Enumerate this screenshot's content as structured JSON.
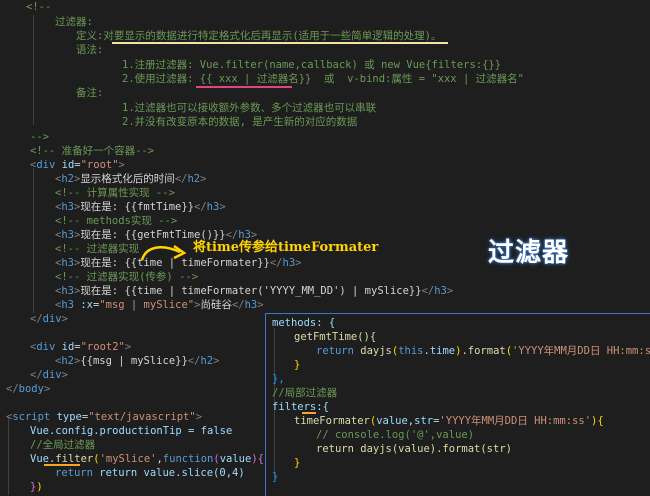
{
  "code": {
    "l1": "<!--",
    "l2_label": "过滤器:",
    "l3_label": "定义:",
    "l3_text": "对要显示的数据进行特定格式化后再显示(适用于一些简单逻辑的处理)。",
    "l4_label": "语法:",
    "l5": "1.注册过滤器: Vue.filter(name,callback) 或 new Vue{filters:{}}",
    "l6a": "2.使用过滤器: ",
    "l6b": "{{ xxx | 过滤器名}}",
    "l6c": "  或  v-bind:属性 = \"xxx | 过滤器名\"",
    "l7_label": "备注:",
    "l8": "1.过滤器也可以接收额外参数、多个过滤器也可以串联",
    "l9": "2.并没有改变原本的数据, 是产生新的对应的数据",
    "l10": "-->",
    "l11": "<!-- 准备好一个容器-->",
    "l12_tag": "div",
    "l12_attr": "id",
    "l12_val": "\"root\"",
    "l13_text": "显示格式化后的时间",
    "l14": "<!-- 计算属性实现 -->",
    "l15_text": "现在是: {{fmtTime}}",
    "l16": "<!-- methods实现 -->",
    "l17_text": "现在是: {{getFmtTime()}}",
    "l18": "<!-- 过滤器实现",
    "l19_text": "现在是: {{time | timeFormater}}",
    "l20": "<!-- 过滤器实现(传参) -->",
    "l21_text": "现在是: {{time | timeFormater('YYYY_MM_DD') | mySlice}}",
    "l22_attr": ":x",
    "l22_val": "\"msg | mySlice\"",
    "l22_text": "尚硅谷",
    "l25_val": "\"root2\"",
    "l26_text": "{{msg | mySlice}}",
    "l29_tag": "body",
    "l31_tag": "script",
    "l31_attr": "type",
    "l31_val": "\"text/javascript\"",
    "l32": "Vue.config.productionTip = false",
    "l33": "//全局过滤器",
    "l34_name": "'mySlice'",
    "l35": "return value.slice(0,4)"
  },
  "popup": {
    "p1": "methods: {",
    "p2": "getFmtTime(){",
    "p3_str": "'YYYY年MM月DD日 HH:mm:ss'",
    "p5": "},",
    "p6": "//局部过滤器",
    "p7": "filters:{",
    "p8_str": "'YYYY年MM月DD日 HH:mm:ss'",
    "p9": "// console.log('@',value)",
    "p10": "return dayjs(value).format(str)"
  },
  "annotation": "将time传参给timeFormater",
  "big_label": "过滤器",
  "colors": {
    "comment": "#6a9955",
    "tag": "#569cd6",
    "string": "#ce9178",
    "annotation": "#ffd400",
    "underline_pink": "#e0467c",
    "underline_orange": "#f5a623"
  }
}
